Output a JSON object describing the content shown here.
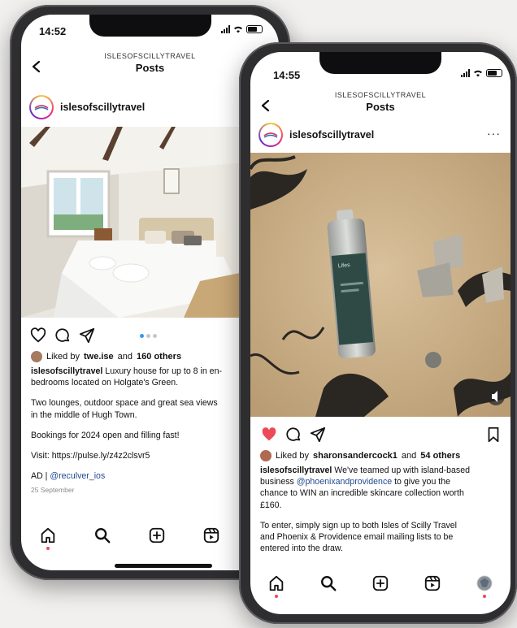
{
  "phone_left": {
    "status": {
      "time": "14:52"
    },
    "header": {
      "account_caps": "ISLESOFSCILLYTRAVEL",
      "title": "Posts"
    },
    "profile": {
      "username": "islesofscillytravel"
    },
    "carousel": {
      "dots": 3,
      "active": 0
    },
    "likes": {
      "prefix": "Liked by",
      "user": "twe.ise",
      "middle": "and",
      "others": "160 others"
    },
    "caption": {
      "author": "islesofscillytravel",
      "line1": "Luxury house for up to 8 in en-",
      "line2": "bedrooms located on Holgate's Green.",
      "para2_line1": "Two lounges, outdoor space and great sea views",
      "para2_line2": "in the middle of Hugh Town.",
      "para3": "Bookings for 2024 open and filling fast!",
      "para4": "Visit: https://pulse.ly/z4z2clsvr5",
      "ad_prefix": "AD |",
      "ad_mention": "@reculver_ios",
      "date": "25 September"
    }
  },
  "phone_right": {
    "status": {
      "time": "14:55"
    },
    "header": {
      "account_caps": "ISLESOFSCILLYTRAVEL",
      "title": "Posts"
    },
    "profile": {
      "username": "islesofscillytravel",
      "more": "···"
    },
    "likes": {
      "prefix": "Liked by",
      "user": "sharonsandercock1",
      "middle": "and",
      "others": "54 others"
    },
    "caption": {
      "author": "islesofscillytravel",
      "line1": "We've teamed up with island-based",
      "line2_prefix": "business",
      "line2_mention": "@phoenixandprovidence",
      "line2_suffix": "to give you the",
      "line3": "chance to WIN an incredible skincare collection worth",
      "line4": "£160.",
      "para2_line1": "To enter, simply sign up to both Isles of Scilly Travel",
      "para2_line2": "and Phoenix & Providence email mailing lists to be",
      "para2_line3": "entered into the draw."
    },
    "bottle_label": "Lifes"
  },
  "colors": {
    "like_red": "#ed4956",
    "mention_blue": "#1f4b8f",
    "text": "#111111",
    "frame": "#2e2e30"
  },
  "icons": {
    "actions": [
      "heart-icon",
      "comment-icon",
      "share-icon",
      "bookmark-icon"
    ],
    "bottom_nav": [
      "home-icon",
      "search-icon",
      "create-post-icon",
      "reels-icon",
      "profile-avatar-icon"
    ]
  }
}
